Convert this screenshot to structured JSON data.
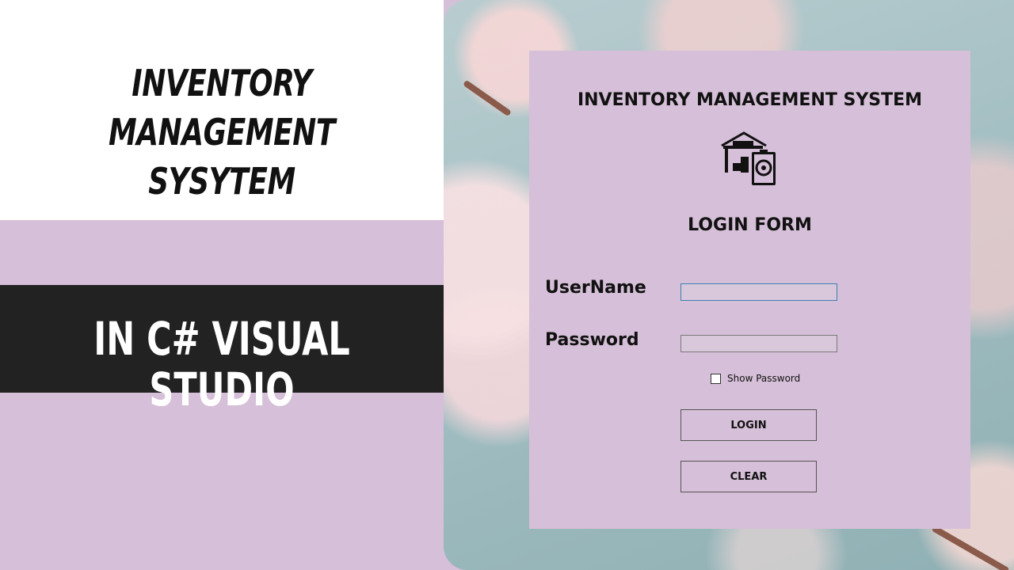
{
  "banner": {
    "title_line1": "INVENTORY MANAGEMENT",
    "title_line2": "SYSYTEM",
    "subtitle": "IN C# VISUAL STUDIO"
  },
  "login_form": {
    "app_title": "INVENTORY MANAGEMENT SYSTEM",
    "icon": "warehouse-icon",
    "form_title": "LOGIN FORM",
    "username_label": "UserName",
    "username_value": "",
    "password_label": "Password",
    "password_value": "",
    "show_password_label": "Show Password",
    "show_password_checked": false,
    "login_button": "LOGIN",
    "clear_button": "CLEAR"
  },
  "colors": {
    "background": "#d6bfd8",
    "band": "#222222",
    "form_background": "#d6bfd8"
  }
}
